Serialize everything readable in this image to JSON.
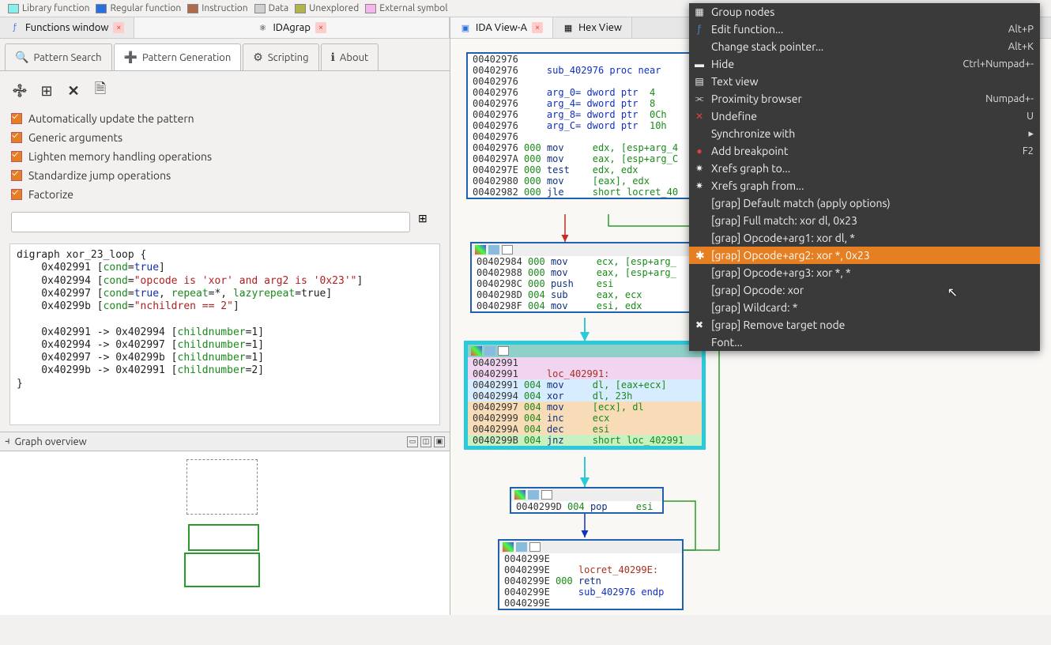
{
  "legend": [
    {
      "color": "#88f0ea",
      "label": "Library function"
    },
    {
      "color": "#2b6fdc",
      "label": "Regular function"
    },
    {
      "color": "#b0694a",
      "label": "Instruction"
    },
    {
      "color": "#cfcfcf",
      "label": "Data"
    },
    {
      "color": "#b3b34e",
      "label": "Unexplored"
    },
    {
      "color": "#f4b6ec",
      "label": "External symbol"
    }
  ],
  "topTabs": {
    "functions": "Functions window",
    "idagrap": "IDAgrap",
    "idaview": "IDA View-A",
    "hexview": "Hex View"
  },
  "subTabs": {
    "search": "Pattern Search",
    "gen": "Pattern Generation",
    "script": "Scripting",
    "about": "About"
  },
  "checks": {
    "auto": "Automatically update the pattern",
    "generic": "Generic arguments",
    "lighten": "Lighten memory handling operations",
    "std": "Standardize jump operations",
    "fact": "Factorize"
  },
  "go": {
    "title": "Graph overview"
  },
  "ctx": {
    "group": "Group nodes",
    "editfn": "Edit function...",
    "editfn_sc": "Alt+P",
    "stack": "Change stack pointer...",
    "stack_sc": "Alt+K",
    "hide": "Hide",
    "hide_sc": "Ctrl+Numpad+-",
    "textview": "Text view",
    "prox": "Proximity browser",
    "prox_sc": "Numpad+-",
    "undef": "Undefine",
    "undef_sc": "U",
    "sync": "Synchronize with",
    "bp": "Add breakpoint",
    "bp_sc": "F2",
    "xrefto": "Xrefs graph to...",
    "xreffrom": "Xrefs graph from...",
    "g_def": "[grap] Default match (apply options)",
    "g_full": "[grap] Full match: xor dl, 0x23",
    "g_a1": "[grap] Opcode+arg1: xor dl, *",
    "g_a2": "[grap] Opcode+arg2: xor *, 0x23",
    "g_a3": "[grap] Opcode+arg3: xor *, *",
    "g_op": "[grap] Opcode: xor",
    "g_wc": "[grap] Wildcard: *",
    "g_rm": "[grap] Remove target node",
    "font": "Font..."
  },
  "code": {
    "l1": "digraph xor_23_loop {",
    "l2a": "    0x402991 [",
    "l2b": "cond",
    "l2c": "=",
    "l2d": "true",
    "l2e": "]",
    "l3a": "    0x402994 [",
    "l3b": "cond",
    "l3c": "=",
    "l3d": "\"opcode is 'xor' and arg2 is '0x23'\"",
    "l3e": "]",
    "l4a": "    0x402997 [",
    "l4b": "cond",
    "l4c": "=",
    "l4d": "true",
    "l4e": ", ",
    "l4f": "repeat",
    "l4g": "=*, ",
    "l4h": "lazyrepeat",
    "l4i": "=true]",
    "l5a": "    0x40299b [",
    "l5b": "cond",
    "l5c": "=",
    "l5d": "\"nchildren == 2\"",
    "l5e": "]",
    "l7a": "    0x402991 -> 0x402994 [",
    "l7b": "childnumber",
    "l7c": "=1]",
    "l8a": "    0x402994 -> 0x402997 [",
    "l8b": "childnumber",
    "l8c": "=1]",
    "l9a": "    0x402997 -> 0x40299b [",
    "l9b": "childnumber",
    "l9c": "=1]",
    "lAa": "    0x40299b -> 0x402991 [",
    "lAb": "childnumber",
    "lAc": "=2]",
    "lB": "}"
  },
  "n1": {
    "l0": "00402976",
    "l1a": "00402976     ",
    "l1b": "sub_402976 proc near",
    "l2": "00402976",
    "l3a": "00402976     ",
    "l3b": "arg_0",
    "l3c": "= dword ptr  ",
    "l3d": "4",
    "l4a": "00402976     ",
    "l4b": "arg_4",
    "l4c": "= dword ptr  ",
    "l4d": "8",
    "l5a": "00402976     ",
    "l5b": "arg_8",
    "l5c": "= dword ptr  ",
    "l5d": "0Ch",
    "l6a": "00402976     ",
    "l6b": "arg_C",
    "l6c": "= dword ptr  ",
    "l6d": "10h",
    "l7": "00402976",
    "l8a": "00402976 ",
    "l8b": "000 ",
    "l8c": "mov     ",
    "l8d": "edx, [esp+arg_4",
    "l9a": "0040297A ",
    "l9b": "000 ",
    "l9c": "mov     ",
    "l9d": "eax, [esp+arg_C",
    "lAa": "0040297E ",
    "lAb": "000 ",
    "lAc": "test    ",
    "lAd": "edx, edx",
    "lBa": "00402980 ",
    "lBb": "000 ",
    "lBc": "mov     ",
    "lBd": "[eax], edx",
    "lCa": "00402982 ",
    "lCb": "000 ",
    "lCc": "jle     ",
    "lCd": "short locret_40"
  },
  "n2": {
    "l1a": "00402984 ",
    "l1b": "000 ",
    "l1c": "mov     ",
    "l1d": "ecx, [esp+arg_",
    "l2a": "00402988 ",
    "l2b": "000 ",
    "l2c": "mov     ",
    "l2d": "eax, [esp+arg_",
    "l3a": "0040298C ",
    "l3b": "000 ",
    "l3c": "push    ",
    "l3d": "esi",
    "l4a": "0040298D ",
    "l4b": "004 ",
    "l4c": "sub     ",
    "l4d": "eax, ecx",
    "l5a": "0040298F ",
    "l5b": "004 ",
    "l5c": "mov     ",
    "l5d": "esi, edx"
  },
  "n3": {
    "l1": "00402991",
    "l2a": "00402991     ",
    "l2b": "loc_402991:",
    "l3a": "00402991 ",
    "l3b": "004 ",
    "l3c": "mov     ",
    "l3d": "dl, [eax+ecx]",
    "l4a": "00402994 ",
    "l4b": "004 ",
    "l4c": "xor     ",
    "l4d": "dl, 23h",
    "l5a": "00402997 ",
    "l5b": "004 ",
    "l5c": "mov     ",
    "l5d": "[ecx], dl",
    "l6a": "00402999 ",
    "l6b": "004 ",
    "l6c": "inc     ",
    "l6d": "ecx",
    "l7a": "0040299A ",
    "l7b": "004 ",
    "l7c": "dec     ",
    "l7d": "esi",
    "l8a": "0040299B ",
    "l8b": "004 ",
    "l8c": "jnz     ",
    "l8d": "short loc_402991"
  },
  "n4": {
    "l1a": "0040299D ",
    "l1b": "004 ",
    "l1c": "pop     ",
    "l1d": "esi"
  },
  "n5": {
    "l1": "0040299E",
    "l2a": "0040299E     ",
    "l2b": "locret_40299E:",
    "l3a": "0040299E ",
    "l3b": "000 ",
    "l3c": "retn",
    "l4a": "0040299E     ",
    "l4b": "sub_402976 endp",
    "l5": "0040299E"
  }
}
